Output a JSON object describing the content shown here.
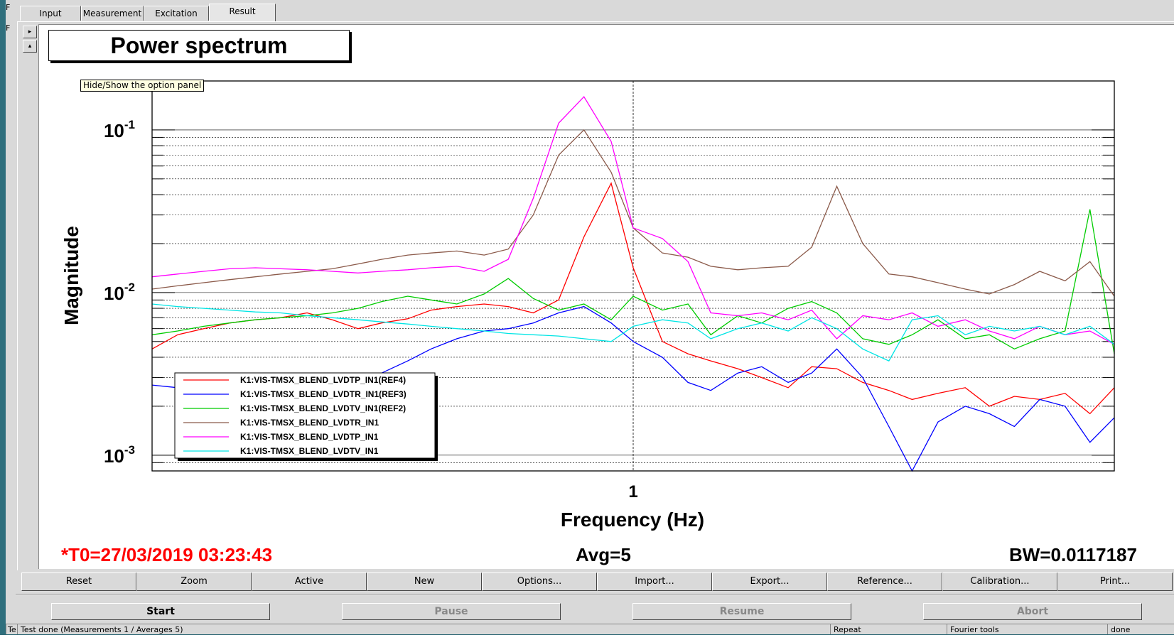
{
  "tabs": [
    "Input",
    "Measurement",
    "Excitation",
    "Result"
  ],
  "title_box": "Power spectrum",
  "tooltip": "Hide/Show the option panel",
  "left_fragments": [
    "F",
    "F"
  ],
  "status_left_fragment": "Te",
  "chart_data": {
    "type": "line",
    "title": "Power spectrum",
    "xlabel": "Frequency (Hz)",
    "ylabel": "Magnitude",
    "x_scale": "log",
    "y_scale": "log",
    "xlim": [
      0.1,
      10
    ],
    "ylim": [
      0.0008,
      0.2
    ],
    "x_tick_labels": [
      "1"
    ],
    "y_tick_labels": [
      {
        "base": "10",
        "exp": "-1",
        "value": 0.1
      },
      {
        "base": "10",
        "exp": "-2",
        "value": 0.01
      },
      {
        "base": "10",
        "exp": "-3",
        "value": 0.001
      }
    ],
    "grid": true,
    "legend_position": "bottom-left",
    "x": [
      0.1,
      0.113,
      0.128,
      0.145,
      0.164,
      0.185,
      0.21,
      0.237,
      0.268,
      0.3,
      0.34,
      0.38,
      0.43,
      0.49,
      0.55,
      0.62,
      0.7,
      0.79,
      0.9,
      1.0,
      1.15,
      1.3,
      1.45,
      1.65,
      1.85,
      2.1,
      2.35,
      2.65,
      3.0,
      3.4,
      3.8,
      4.3,
      4.9,
      5.5,
      6.2,
      7.0,
      7.9,
      8.9,
      10.0
    ],
    "series": [
      {
        "name": "K1:VIS-TMSX_BLEND_LVDTP_IN1(REF4)",
        "color": "#ff0000",
        "values": [
          0.0045,
          0.0055,
          0.006,
          0.0065,
          0.0068,
          0.007,
          0.0075,
          0.0068,
          0.006,
          0.0065,
          0.0069,
          0.0078,
          0.0082,
          0.0085,
          0.0082,
          0.0075,
          0.009,
          0.022,
          0.047,
          0.0142,
          0.005,
          0.0042,
          0.0038,
          0.0034,
          0.003,
          0.0026,
          0.0035,
          0.0034,
          0.0028,
          0.0025,
          0.0022,
          0.0024,
          0.0026,
          0.002,
          0.0023,
          0.0022,
          0.0024,
          0.0018,
          0.0026
        ]
      },
      {
        "name": "K1:VIS-TMSX_BLEND_LVDTR_IN1(REF3)",
        "color": "#0000ff",
        "values": [
          0.0027,
          0.0026,
          0.0024,
          0.0023,
          0.0022,
          0.0023,
          0.0025,
          0.0026,
          0.0028,
          0.0032,
          0.0038,
          0.0045,
          0.0052,
          0.0058,
          0.006,
          0.0065,
          0.0075,
          0.0082,
          0.0065,
          0.005,
          0.004,
          0.0028,
          0.0025,
          0.0032,
          0.0035,
          0.0028,
          0.0032,
          0.0045,
          0.003,
          0.0015,
          0.0008,
          0.0016,
          0.002,
          0.0018,
          0.0015,
          0.0022,
          0.002,
          0.0012,
          0.0017
        ]
      },
      {
        "name": "K1:VIS-TMSX_BLEND_LVDTV_IN1(REF2)",
        "color": "#00cc00",
        "values": [
          0.0055,
          0.0058,
          0.0062,
          0.0065,
          0.0068,
          0.007,
          0.0072,
          0.0075,
          0.008,
          0.0088,
          0.0095,
          0.009,
          0.0085,
          0.0098,
          0.0122,
          0.0092,
          0.0078,
          0.0085,
          0.0068,
          0.0095,
          0.0078,
          0.0085,
          0.0055,
          0.0072,
          0.0065,
          0.008,
          0.0088,
          0.0075,
          0.0052,
          0.0048,
          0.0055,
          0.0068,
          0.0052,
          0.0055,
          0.0045,
          0.0052,
          0.0058,
          0.0325,
          0.0042
        ]
      },
      {
        "name": "K1:VIS-TMSX_BLEND_LVDTR_IN1",
        "color": "#8b5a4a",
        "values": [
          0.0105,
          0.011,
          0.0115,
          0.012,
          0.0125,
          0.013,
          0.0135,
          0.014,
          0.015,
          0.016,
          0.017,
          0.0175,
          0.018,
          0.017,
          0.0185,
          0.03,
          0.07,
          0.1,
          0.055,
          0.025,
          0.0175,
          0.0165,
          0.0145,
          0.0138,
          0.0142,
          0.0145,
          0.019,
          0.045,
          0.02,
          0.013,
          0.0125,
          0.0115,
          0.0105,
          0.0098,
          0.0112,
          0.0135,
          0.0118,
          0.0155,
          0.0095
        ]
      },
      {
        "name": "K1:VIS-TMSX_BLEND_LVDTP_IN1",
        "color": "#ff00ff",
        "values": [
          0.0125,
          0.013,
          0.0135,
          0.014,
          0.0142,
          0.014,
          0.0138,
          0.0135,
          0.0132,
          0.0135,
          0.0138,
          0.0142,
          0.0145,
          0.0135,
          0.016,
          0.038,
          0.11,
          0.16,
          0.085,
          0.025,
          0.0215,
          0.0155,
          0.0075,
          0.0072,
          0.0075,
          0.0068,
          0.0078,
          0.0052,
          0.0072,
          0.0068,
          0.0075,
          0.0062,
          0.0068,
          0.0058,
          0.0052,
          0.0062,
          0.0055,
          0.0058,
          0.0048
        ]
      },
      {
        "name": "K1:VIS-TMSX_BLEND_LVDTV_IN1",
        "color": "#00e5e5",
        "values": [
          0.0085,
          0.0082,
          0.008,
          0.0078,
          0.0076,
          0.0075,
          0.0072,
          0.007,
          0.0068,
          0.0066,
          0.0064,
          0.0062,
          0.006,
          0.0058,
          0.0056,
          0.0055,
          0.0054,
          0.0052,
          0.005,
          0.0062,
          0.0068,
          0.0065,
          0.0052,
          0.006,
          0.0065,
          0.0058,
          0.007,
          0.006,
          0.0045,
          0.0038,
          0.0068,
          0.0072,
          0.0055,
          0.0062,
          0.0058,
          0.0062,
          0.0055,
          0.0062,
          0.0048
        ]
      }
    ]
  },
  "info": {
    "t0": "*T0=27/03/2019 03:23:43",
    "avg": "Avg=5",
    "bw": "BW=0.0117187"
  },
  "toolbar": [
    "Reset",
    "Zoom",
    "Active",
    "New",
    "Options...",
    "Import...",
    "Export...",
    "Reference...",
    "Calibration...",
    "Print..."
  ],
  "controls": {
    "start": "Start",
    "pause": "Pause",
    "resume": "Resume",
    "abort": "Abort"
  },
  "statusbar": {
    "message": "Test done (Measurements 1 / Averages 5)",
    "repeat": "Repeat",
    "tools": "Fourier tools",
    "state": "done"
  }
}
